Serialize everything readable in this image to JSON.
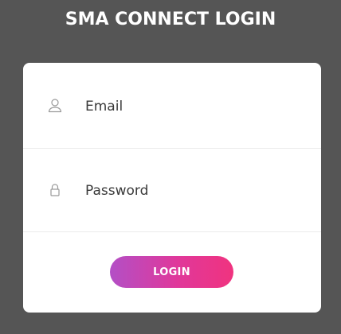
{
  "header": {
    "title": "SMA CONNECT LOGIN"
  },
  "form": {
    "email": {
      "placeholder": "Email",
      "value": "",
      "icon": "user-icon"
    },
    "password": {
      "placeholder": "Password",
      "value": "",
      "icon": "lock-icon"
    },
    "login_label": "LOGIN"
  },
  "colors": {
    "background": "#555555",
    "card": "#ffffff",
    "button_gradient_start": "#b34fc6",
    "button_gradient_end": "#f0337f"
  }
}
